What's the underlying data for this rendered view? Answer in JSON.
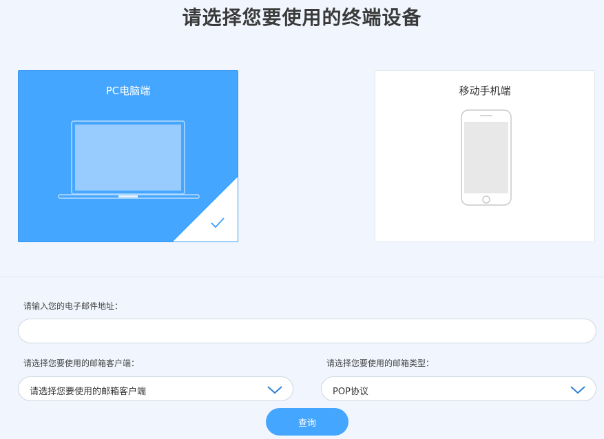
{
  "title": "请选择您要使用的终端设备",
  "devices": {
    "pc": {
      "label": "PC电脑端",
      "selected": true
    },
    "mobile": {
      "label": "移动手机端",
      "selected": false
    }
  },
  "form": {
    "email_label": "请输入您的电子邮件地址：",
    "email_value": "",
    "client_label": "请选择您要使用的邮箱客户端：",
    "client_value": "请选择您要使用的邮箱客户端",
    "type_label": "请选择您要使用的邮箱类型：",
    "type_value": "POP协议",
    "submit_label": "查询"
  },
  "colors": {
    "accent": "#44a6fe",
    "background": "#f1f6fe"
  },
  "icons": {
    "pc": "laptop-icon",
    "mobile": "phone-icon",
    "selected": "check-icon",
    "dropdown": "chevron-down-icon"
  }
}
